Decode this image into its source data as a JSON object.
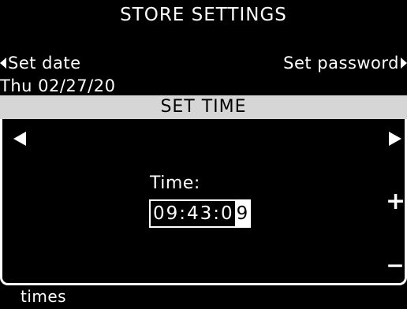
{
  "title": "STORE SETTINGS",
  "nav": {
    "prev_label": "Set date",
    "next_label": "Set password"
  },
  "date_display": "Thu 02/27/20",
  "section_title": "SET TIME",
  "time": {
    "label": "Time:",
    "value_prefix": "09:43:0",
    "value_cursor": "9"
  },
  "controls": {
    "plus": "+",
    "minus": "−"
  },
  "footer_text": "times",
  "icons": {
    "prev_small": "triangle-left-icon",
    "next_small": "triangle-right-icon",
    "scroll_left": "arrow-left-icon",
    "scroll_right": "arrow-right-icon"
  },
  "colors": {
    "background": "#000000",
    "text": "#ffffff",
    "header_bar": "#d6d6d6",
    "header_text": "#000000"
  }
}
